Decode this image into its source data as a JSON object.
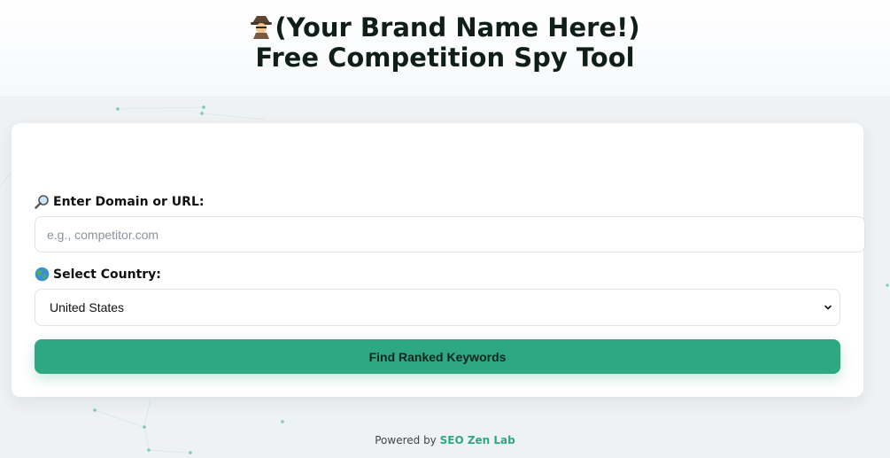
{
  "header": {
    "title_line1": "(Your Brand Name Here!)",
    "title_line2": "Free Competition Spy Tool",
    "icon": "detective-icon"
  },
  "form": {
    "domain_label": "Enter Domain or URL:",
    "domain_icon": "magnifier-icon",
    "domain_placeholder": "e.g., competitor.com",
    "domain_value": "",
    "country_label": "Select Country:",
    "country_icon": "globe-icon",
    "country_selected": "United States",
    "submit_label": "Find Ranked Keywords"
  },
  "footer": {
    "prefix": "Powered by",
    "brand": "SEO Zen Lab"
  },
  "colors": {
    "accent": "#2ea783",
    "background": "#eef2f4"
  }
}
